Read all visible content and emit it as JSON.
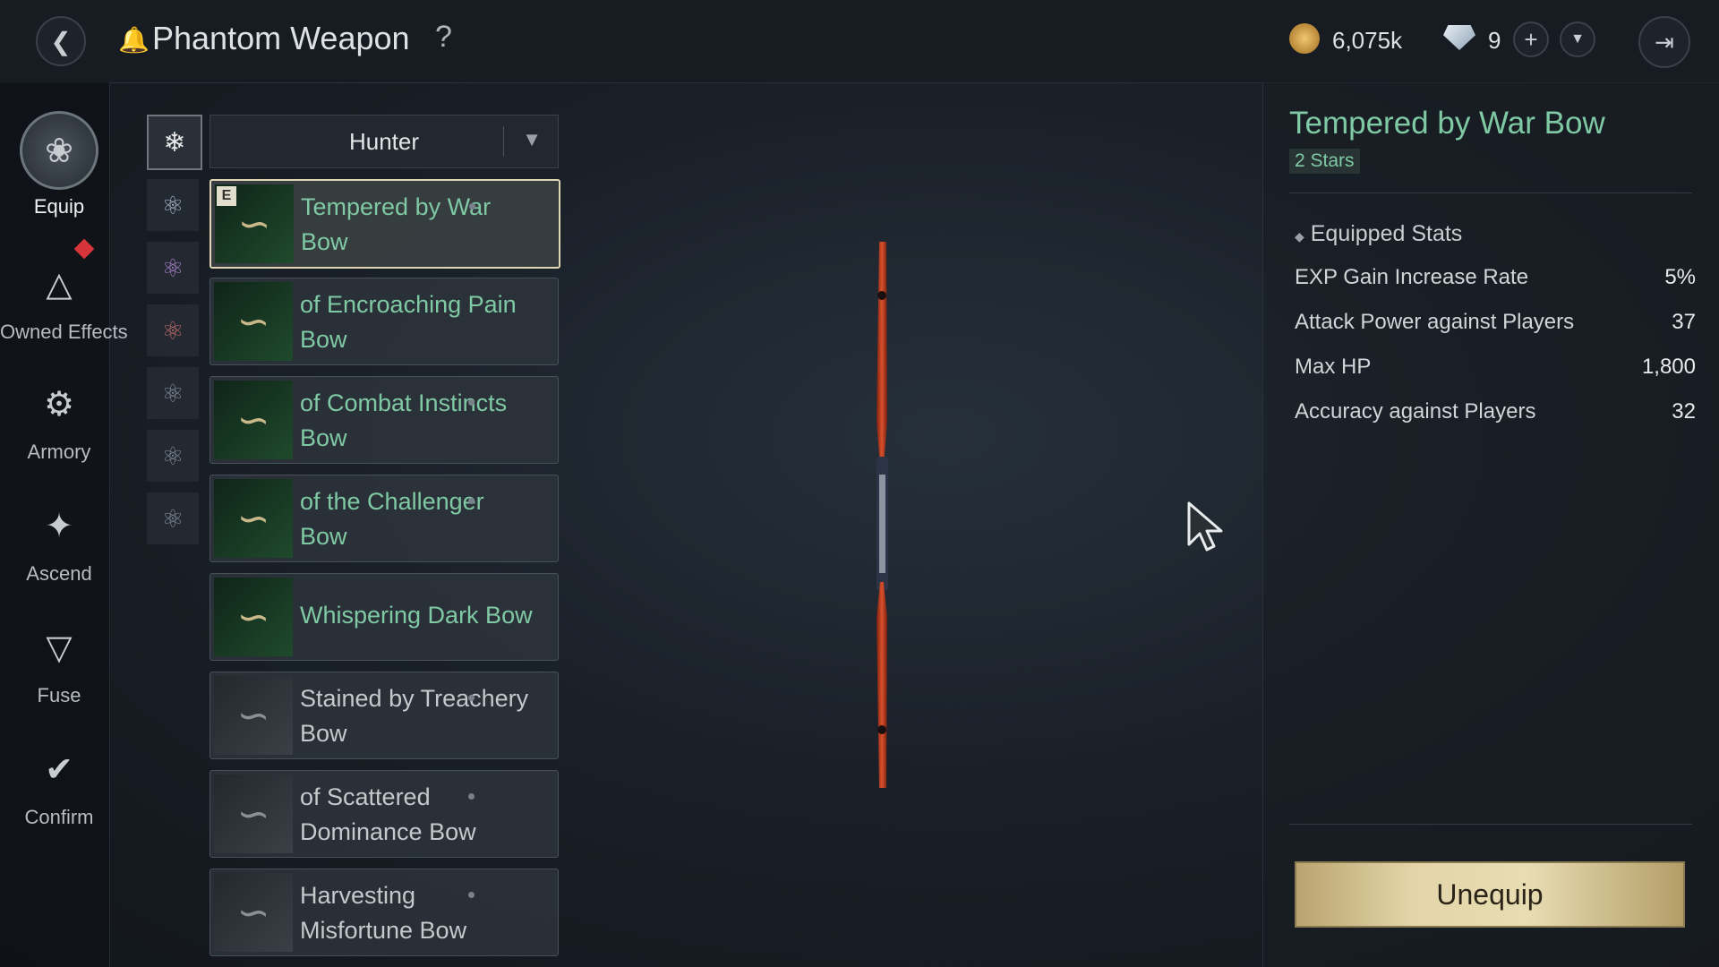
{
  "header": {
    "title": "Phantom Weapon",
    "help": "?",
    "gold": "6,075k",
    "gems": "9"
  },
  "sidebar": {
    "items": [
      {
        "label": "Equip",
        "icon": "equip-icon"
      },
      {
        "label": "Owned Effects",
        "icon": "owned-effects-icon"
      },
      {
        "label": "Armory",
        "icon": "armory-icon"
      },
      {
        "label": "Ascend",
        "icon": "ascend-icon"
      },
      {
        "label": "Fuse",
        "icon": "fuse-icon"
      },
      {
        "label": "Confirm",
        "icon": "confirm-icon"
      }
    ]
  },
  "filter": {
    "selected": "Hunter"
  },
  "weapons": [
    {
      "name": "Tempered by War Bow",
      "equipped_badge": "E",
      "color": "#7fc9a4"
    },
    {
      "name": "of Encroaching Pain Bow",
      "color": "#7fc9a4"
    },
    {
      "name": "of Combat Instincts Bow",
      "color": "#7fc9a4"
    },
    {
      "name": "of the Challenger Bow",
      "color": "#7fc9a4"
    },
    {
      "name": "Whispering Dark Bow",
      "color": "#7fc9a4"
    },
    {
      "name": "Stained by Treachery Bow",
      "color": "#c5c9cc"
    },
    {
      "name": "of Scattered Dominance Bow",
      "color": "#c5c9cc"
    },
    {
      "name": "Harvesting Misfortune Bow",
      "color": "#c5c9cc"
    }
  ],
  "detail": {
    "name": "Tempered by War Bow",
    "stars": "2 Stars",
    "section": "Equipped Stats",
    "stats": [
      {
        "name": "EXP Gain Increase Rate",
        "value": "5%"
      },
      {
        "name": "Attack Power against Players",
        "value": "37"
      },
      {
        "name": "Max HP",
        "value": "1,800"
      },
      {
        "name": "Accuracy against Players",
        "value": "32"
      }
    ],
    "action": "Unequip"
  }
}
